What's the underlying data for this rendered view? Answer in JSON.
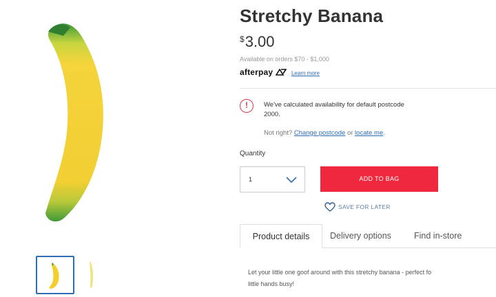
{
  "product": {
    "title": "Stretchy Banana",
    "price_currency": "$",
    "price_amount": "3.00",
    "availability": "Available on orders $70 - $1,000",
    "afterpay_brand": "afterpay",
    "afterpay_learn": "Learn more"
  },
  "notice": {
    "icon_glyph": "!",
    "message": "We've calculated availability for default postcode 2000.",
    "not_right": "Not right?",
    "change_postcode": "Change postcode",
    "or": "or",
    "locate_me": "locate me",
    "period": "."
  },
  "quantity": {
    "label": "Quantity",
    "value": "1"
  },
  "actions": {
    "add_to_bag": "ADD TO BAG",
    "save_for_later": "SAVE FOR LATER"
  },
  "tabs": [
    {
      "label": "Product details",
      "active": true
    },
    {
      "label": "Delivery options",
      "active": false
    },
    {
      "label": "Find in-store",
      "active": false
    }
  ],
  "description": {
    "line1": "Let your little one goof around with this stretchy banana - perfect fo",
    "line2": "little hands busy!"
  },
  "icons": {
    "info": "info-circle-icon",
    "chevron": "chevron-down-icon",
    "heart": "heart-outline-icon"
  },
  "colors": {
    "accent_red": "#f0283d",
    "link_blue": "#2f6db5",
    "thumb_border": "#2f6db5",
    "banana_yellow": "#f5d33b",
    "banana_green": "#4fa33c"
  }
}
